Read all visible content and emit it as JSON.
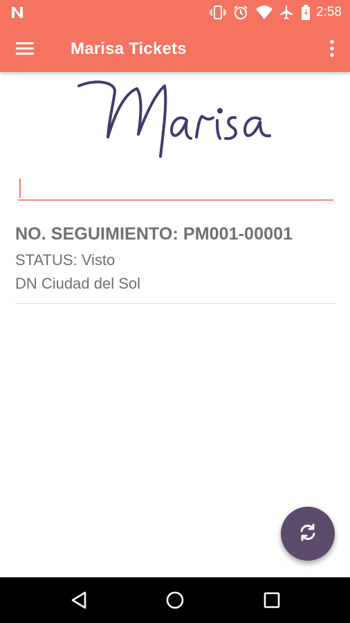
{
  "status_bar": {
    "time": "2:58",
    "icons": [
      "n-notification-icon",
      "vibrate-icon",
      "alarm-icon",
      "wifi-icon",
      "airplane-mode-icon",
      "battery-icon"
    ]
  },
  "app_bar": {
    "title": "Marisa Tickets",
    "menu_icon": "hamburger-menu-icon",
    "overflow_icon": "more-vert-icon",
    "color": "#f57461"
  },
  "logo": {
    "text": "Marisa",
    "color": "#3f3b6e"
  },
  "search": {
    "value": "",
    "placeholder": ""
  },
  "tickets": [
    {
      "tracking": "NO. SEGUIMIENTO: PM001-00001",
      "status": "STATUS: Visto",
      "location": "DN Ciudad del Sol"
    }
  ],
  "fab": {
    "icon": "refresh-icon",
    "color": "#5d4b6e"
  },
  "nav_bar": {
    "icons": [
      "back-icon",
      "home-icon",
      "recents-icon"
    ]
  }
}
